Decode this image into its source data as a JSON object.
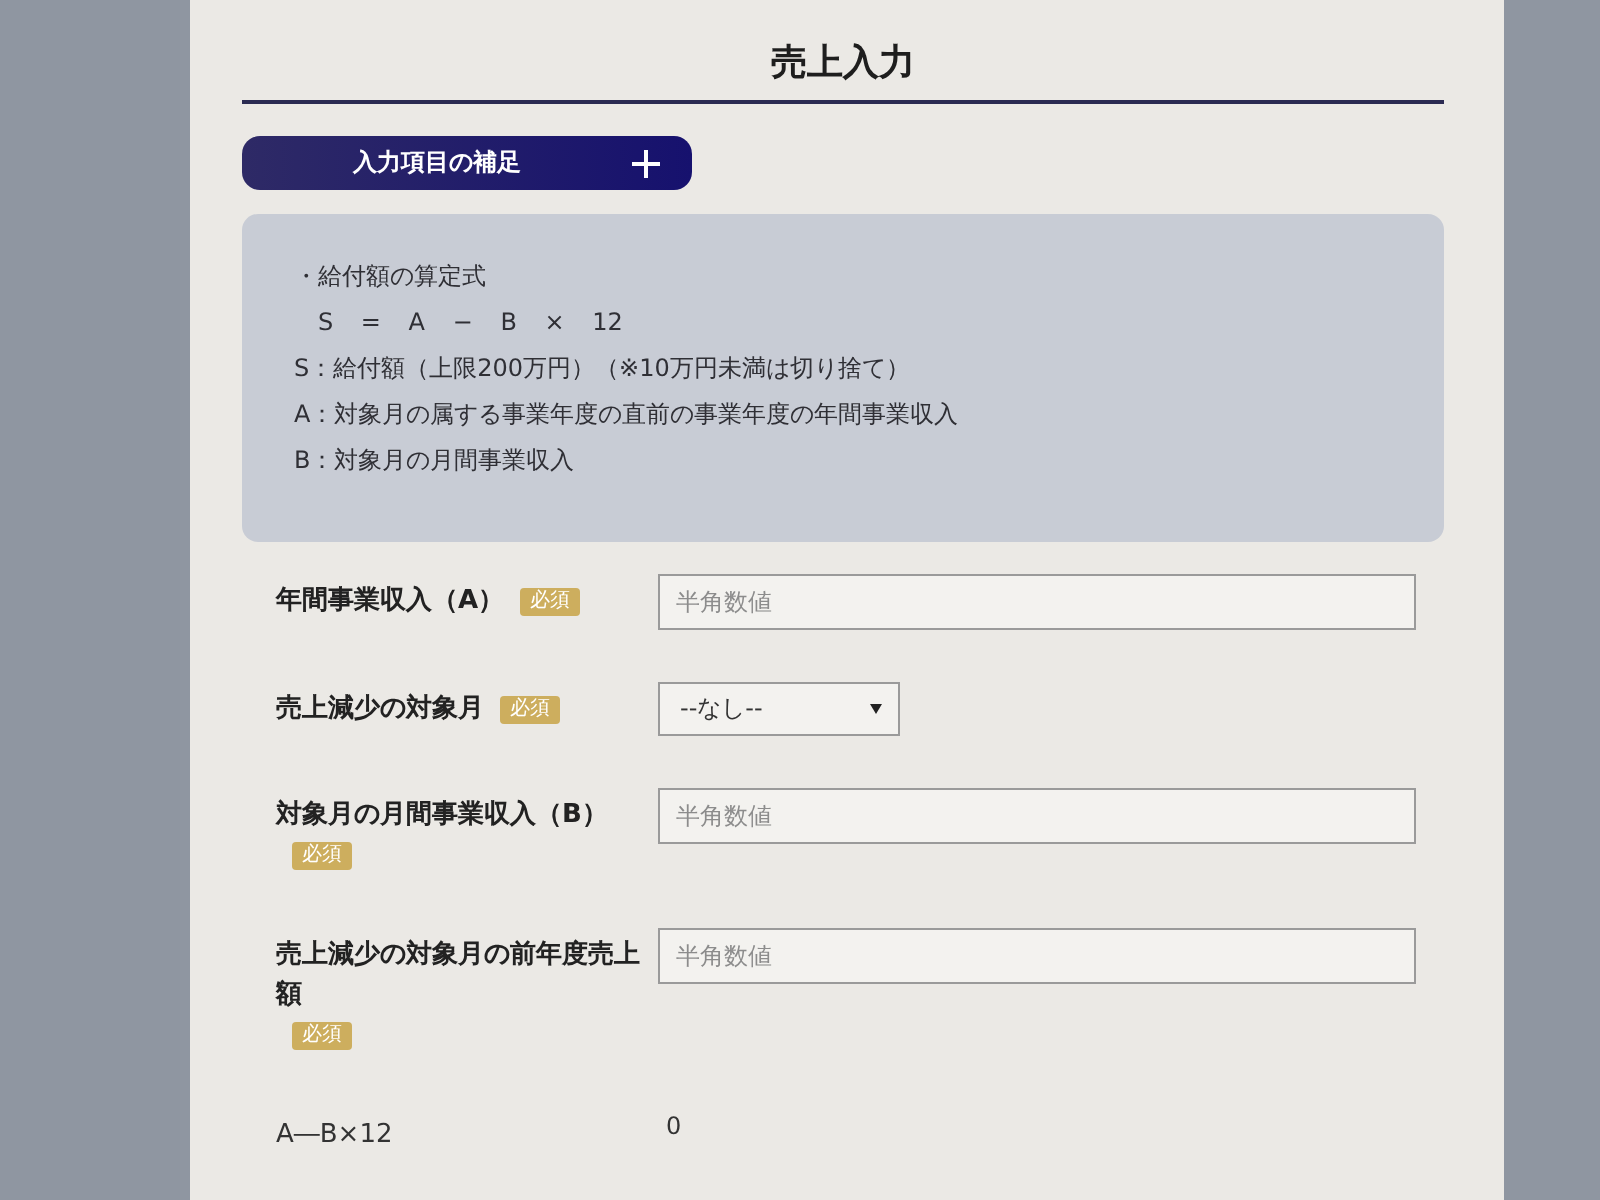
{
  "page": {
    "title": "売上入力"
  },
  "supplement_button": {
    "label": "入力項目の補足"
  },
  "info_box": {
    "heading": "・給付額の算定式",
    "formula": "S = A − B × 12",
    "definitions": [
      "S：給付額（上限200万円）（※10万円未満は切り捨て）",
      "A：対象月の属する事業年度の直前の事業年度の年間事業収入",
      "B：対象月の月間事業収入"
    ]
  },
  "fields": [
    {
      "kind": "text",
      "label": "年間事業収入（A）",
      "badge": "必須",
      "placeholder": "半角数値"
    },
    {
      "kind": "select",
      "label": "売上減少の対象月",
      "badge": "必須",
      "value": "--なし--"
    },
    {
      "kind": "text",
      "label": "対象月の月間事業収入（B）",
      "badge": "必須",
      "placeholder": "半角数値"
    },
    {
      "kind": "text",
      "label": "売上減少の対象月の前年度売上額",
      "badge": "必須",
      "placeholder": "半角数値"
    },
    {
      "kind": "output",
      "label": "A―B×12",
      "value": "0"
    }
  ]
}
